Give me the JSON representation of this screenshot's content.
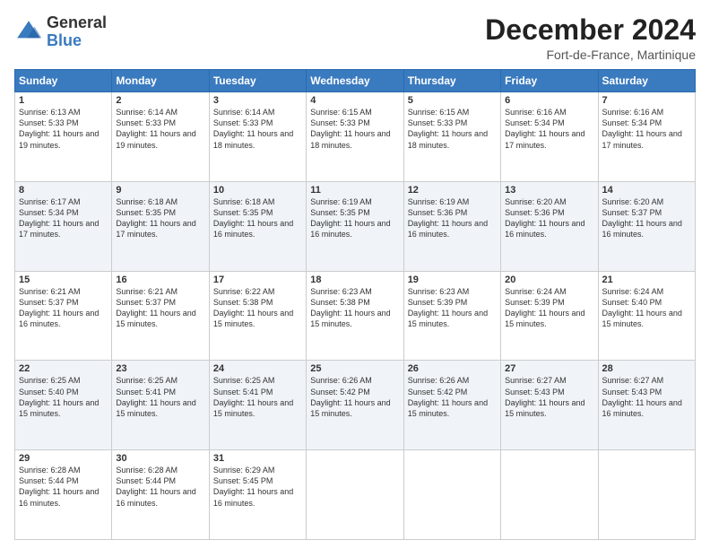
{
  "logo": {
    "general": "General",
    "blue": "Blue"
  },
  "title": {
    "month": "December 2024",
    "location": "Fort-de-France, Martinique"
  },
  "headers": [
    "Sunday",
    "Monday",
    "Tuesday",
    "Wednesday",
    "Thursday",
    "Friday",
    "Saturday"
  ],
  "weeks": [
    [
      {
        "day": "1",
        "sunrise": "6:13 AM",
        "sunset": "5:33 PM",
        "daylight": "11 hours and 19 minutes."
      },
      {
        "day": "2",
        "sunrise": "6:14 AM",
        "sunset": "5:33 PM",
        "daylight": "11 hours and 19 minutes."
      },
      {
        "day": "3",
        "sunrise": "6:14 AM",
        "sunset": "5:33 PM",
        "daylight": "11 hours and 18 minutes."
      },
      {
        "day": "4",
        "sunrise": "6:15 AM",
        "sunset": "5:33 PM",
        "daylight": "11 hours and 18 minutes."
      },
      {
        "day": "5",
        "sunrise": "6:15 AM",
        "sunset": "5:33 PM",
        "daylight": "11 hours and 18 minutes."
      },
      {
        "day": "6",
        "sunrise": "6:16 AM",
        "sunset": "5:34 PM",
        "daylight": "11 hours and 17 minutes."
      },
      {
        "day": "7",
        "sunrise": "6:16 AM",
        "sunset": "5:34 PM",
        "daylight": "11 hours and 17 minutes."
      }
    ],
    [
      {
        "day": "8",
        "sunrise": "6:17 AM",
        "sunset": "5:34 PM",
        "daylight": "11 hours and 17 minutes."
      },
      {
        "day": "9",
        "sunrise": "6:18 AM",
        "sunset": "5:35 PM",
        "daylight": "11 hours and 17 minutes."
      },
      {
        "day": "10",
        "sunrise": "6:18 AM",
        "sunset": "5:35 PM",
        "daylight": "11 hours and 16 minutes."
      },
      {
        "day": "11",
        "sunrise": "6:19 AM",
        "sunset": "5:35 PM",
        "daylight": "11 hours and 16 minutes."
      },
      {
        "day": "12",
        "sunrise": "6:19 AM",
        "sunset": "5:36 PM",
        "daylight": "11 hours and 16 minutes."
      },
      {
        "day": "13",
        "sunrise": "6:20 AM",
        "sunset": "5:36 PM",
        "daylight": "11 hours and 16 minutes."
      },
      {
        "day": "14",
        "sunrise": "6:20 AM",
        "sunset": "5:37 PM",
        "daylight": "11 hours and 16 minutes."
      }
    ],
    [
      {
        "day": "15",
        "sunrise": "6:21 AM",
        "sunset": "5:37 PM",
        "daylight": "11 hours and 16 minutes."
      },
      {
        "day": "16",
        "sunrise": "6:21 AM",
        "sunset": "5:37 PM",
        "daylight": "11 hours and 15 minutes."
      },
      {
        "day": "17",
        "sunrise": "6:22 AM",
        "sunset": "5:38 PM",
        "daylight": "11 hours and 15 minutes."
      },
      {
        "day": "18",
        "sunrise": "6:23 AM",
        "sunset": "5:38 PM",
        "daylight": "11 hours and 15 minutes."
      },
      {
        "day": "19",
        "sunrise": "6:23 AM",
        "sunset": "5:39 PM",
        "daylight": "11 hours and 15 minutes."
      },
      {
        "day": "20",
        "sunrise": "6:24 AM",
        "sunset": "5:39 PM",
        "daylight": "11 hours and 15 minutes."
      },
      {
        "day": "21",
        "sunrise": "6:24 AM",
        "sunset": "5:40 PM",
        "daylight": "11 hours and 15 minutes."
      }
    ],
    [
      {
        "day": "22",
        "sunrise": "6:25 AM",
        "sunset": "5:40 PM",
        "daylight": "11 hours and 15 minutes."
      },
      {
        "day": "23",
        "sunrise": "6:25 AM",
        "sunset": "5:41 PM",
        "daylight": "11 hours and 15 minutes."
      },
      {
        "day": "24",
        "sunrise": "6:25 AM",
        "sunset": "5:41 PM",
        "daylight": "11 hours and 15 minutes."
      },
      {
        "day": "25",
        "sunrise": "6:26 AM",
        "sunset": "5:42 PM",
        "daylight": "11 hours and 15 minutes."
      },
      {
        "day": "26",
        "sunrise": "6:26 AM",
        "sunset": "5:42 PM",
        "daylight": "11 hours and 15 minutes."
      },
      {
        "day": "27",
        "sunrise": "6:27 AM",
        "sunset": "5:43 PM",
        "daylight": "11 hours and 15 minutes."
      },
      {
        "day": "28",
        "sunrise": "6:27 AM",
        "sunset": "5:43 PM",
        "daylight": "11 hours and 16 minutes."
      }
    ],
    [
      {
        "day": "29",
        "sunrise": "6:28 AM",
        "sunset": "5:44 PM",
        "daylight": "11 hours and 16 minutes."
      },
      {
        "day": "30",
        "sunrise": "6:28 AM",
        "sunset": "5:44 PM",
        "daylight": "11 hours and 16 minutes."
      },
      {
        "day": "31",
        "sunrise": "6:29 AM",
        "sunset": "5:45 PM",
        "daylight": "11 hours and 16 minutes."
      },
      null,
      null,
      null,
      null
    ]
  ]
}
